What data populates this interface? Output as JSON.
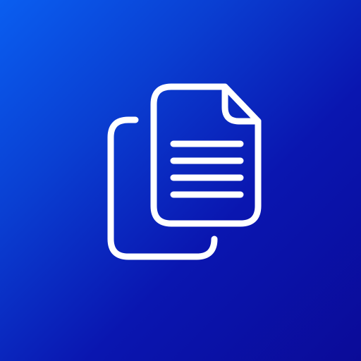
{
  "icon": {
    "name": "copy-documents-icon",
    "stroke_color": "#ffffff"
  },
  "background": {
    "gradient_start": "#0a5ef0",
    "gradient_end": "#0b0b98"
  }
}
